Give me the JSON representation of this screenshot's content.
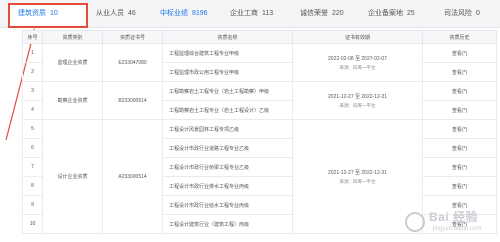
{
  "tabs": [
    {
      "label": "建筑资质",
      "count": "10",
      "state": "active"
    },
    {
      "label": "从业人员",
      "count": "46",
      "state": "normal"
    },
    {
      "label": "中标业绩",
      "count": "8196",
      "state": "blue"
    },
    {
      "label": "企业工商",
      "count": "113",
      "state": "normal"
    },
    {
      "label": "诚信荣誉",
      "count": "220",
      "state": "normal"
    },
    {
      "label": "企业备案地",
      "count": "25",
      "state": "normal"
    },
    {
      "label": "司法风险",
      "count": "0",
      "state": "normal"
    }
  ],
  "table": {
    "headers": [
      "序号",
      "资质类别",
      "资质证书号",
      "资质名称",
      "证书有效期",
      "资质历史"
    ],
    "groups": [
      {
        "category": "监理企业资质",
        "cert_no": "E233047080",
        "validity": "2022-02-08 至 2027-02-07",
        "source": "来源：四库一平台",
        "rows": [
          {
            "no": "1",
            "name": "工程监理综合建筑工程专业甲级",
            "history": "查看(*)"
          },
          {
            "no": "2",
            "name": "工程监理市政公用工程专业甲级",
            "history": "查看(*)"
          }
        ]
      },
      {
        "category": "勘察企业资质",
        "cert_no": "B233000514",
        "validity": "2021-12-27 至 2022-12-31",
        "source": "来源：四库一平台",
        "rows": [
          {
            "no": "3",
            "name": "工程勘察岩土工程专业（岩土工程勘察）甲级",
            "history": "查看(*)"
          },
          {
            "no": "4",
            "name": "工程勘察岩土工程专业（岩土工程设计）乙级",
            "history": "查看(*)"
          }
        ]
      },
      {
        "category": "设计企业资质",
        "cert_no": "A233000514",
        "validity": "2021-12-27 至 2022-12-31",
        "source": "来源：四库一平台",
        "rows": [
          {
            "no": "5",
            "name": "工程设计风景园林工程专项乙级",
            "history": "查看(*)"
          },
          {
            "no": "6",
            "name": "工程设计市政行业道路工程专业乙级",
            "history": "查看(*)"
          },
          {
            "no": "7",
            "name": "工程设计市政行业桥梁工程专业乙级",
            "history": "查看(*)"
          },
          {
            "no": "8",
            "name": "工程设计市政行业排水工程专业丙级",
            "history": "查看(*)"
          },
          {
            "no": "9",
            "name": "工程设计市政行业给水工程专业丙级",
            "history": "查看(*)"
          },
          {
            "no": "10",
            "name": "工程设计建筑行业（建筑工程）丙级",
            "history": "查看(*)"
          }
        ]
      }
    ]
  },
  "watermark": {
    "brand": "Bai 经验",
    "url": "jingyan.baidu.com"
  },
  "colors": {
    "accent": "#1e78e6",
    "highlight": "#e34a3b",
    "header_bg": "#f6f7f9"
  }
}
